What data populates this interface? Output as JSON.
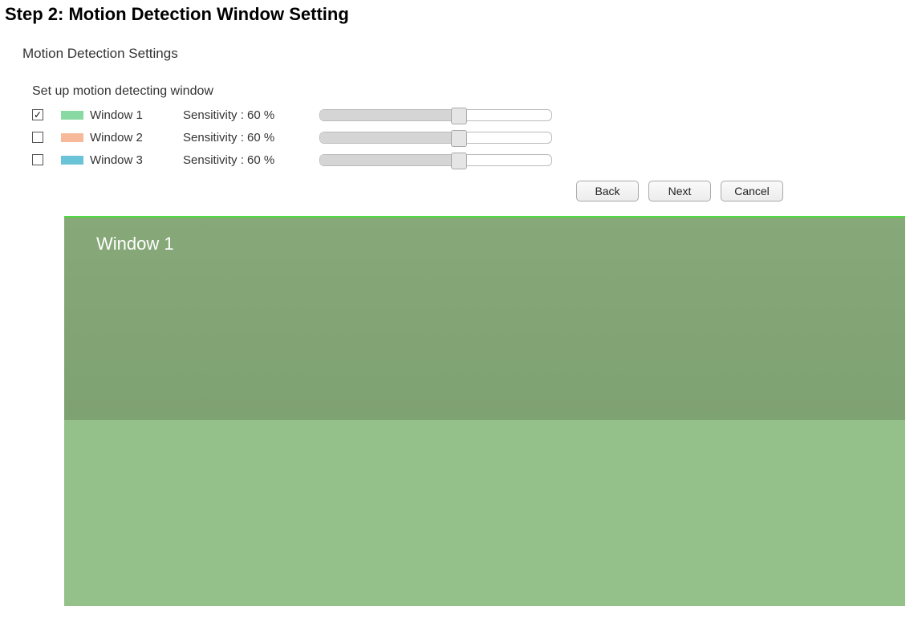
{
  "step_heading": "Step 2: Motion Detection Window Setting",
  "panel_title": "Motion Detection Settings",
  "subtitle": "Set up motion detecting window",
  "windows": [
    {
      "checked": true,
      "swatch": "#89d9a3",
      "label": "Window 1",
      "sensitivity_label": "Sensitivity : 60 %",
      "sensitivity_pct": 60
    },
    {
      "checked": false,
      "swatch": "#f6b99a",
      "label": "Window 2",
      "sensitivity_label": "Sensitivity : 60 %",
      "sensitivity_pct": 60
    },
    {
      "checked": false,
      "swatch": "#6ac3d7",
      "label": "Window 3",
      "sensitivity_label": "Sensitivity : 60 %",
      "sensitivity_pct": 60
    }
  ],
  "buttons": {
    "back": "Back",
    "next": "Next",
    "cancel": "Cancel"
  },
  "preview": {
    "overlay_label": "Window 1"
  }
}
